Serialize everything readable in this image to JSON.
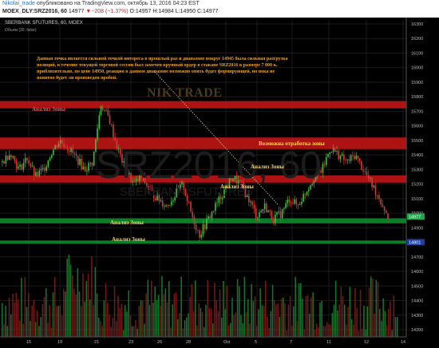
{
  "header": {
    "author": "Nikolai_trade",
    "published": "опубликовано на TradingView.com, октябрь 13, 2016 04:23 EST",
    "symbol": "MOEX_DLY:SRZ2016, 60",
    "last": "14977",
    "change": "▼−208 (−1.37%)",
    "ohlc": "O:14957 H:14984 L:14950 C:14977"
  },
  "chart_title": "SBERBANK SFUTURES, 60, MOEX",
  "volume_label": "Объем (20, false)",
  "watermark": "NIK TRADE",
  "background_symbol": "SRZ2016, 60",
  "background_desc": "SBERBANK SFUTURES",
  "comment": "Данная точка является сильной точкой интереса в прошлый раз и диапазоне вокруг 14945 была сильная разгрузка позиций, в течение текущей торговой сессии был замечен крупный ордер в стакане SRZ2016 в размере 7 000 к. приблизительно, по цене 14950, реакция в данном диапазоне возможно опять будет формирующей, но пока не понятно будет ли произведен пробой.",
  "zone_labels": [
    {
      "text": "Анализ Зоны",
      "color": "#ff4d4d"
    },
    {
      "text": "Возможна отработка зоны",
      "color": "#ffd54a"
    },
    {
      "text": "Анализ Зоны",
      "color": "#ffd54a"
    },
    {
      "text": "Анализ Зоны",
      "color": "#ffd54a"
    },
    {
      "text": "Анализ Зоны",
      "color": "#ffd54a"
    },
    {
      "text": "Анализ Зоны",
      "color": "#ffd54a"
    }
  ],
  "chart_data": {
    "type": "candlestick",
    "x_ticks": [
      "15",
      "19",
      "21",
      "23",
      "26",
      "28",
      "Oct",
      "5",
      "7",
      "11",
      "12",
      "14"
    ],
    "y_ticks": [
      16300,
      16200,
      16100,
      16000,
      15900,
      15800,
      15700,
      15600,
      15500,
      15400,
      15300,
      15200,
      15100,
      15000,
      14900,
      14800,
      14700,
      14600,
      14500,
      14400,
      14300,
      14200
    ],
    "ylim": [
      14150,
      16350
    ],
    "price_badges": [
      {
        "value": "14977",
        "color": "#1fa84a"
      },
      {
        "value": "14801",
        "color": "#1f3fa0"
      }
    ],
    "zones": [
      {
        "low": 15720,
        "high": 15770,
        "color": "#c01515"
      },
      {
        "low": 15440,
        "high": 15520,
        "color": "#c01515"
      },
      {
        "low": 15210,
        "high": 15260,
        "color": "#c01515"
      },
      {
        "low": 14930,
        "high": 14965,
        "color": "#0e8a2a"
      },
      {
        "low": 14790,
        "high": 14812,
        "color": "#0e8a2a"
      }
    ],
    "volume": "histogram at bottom of panel, red and green bars",
    "approx_close_path": [
      15350,
      15420,
      15300,
      15380,
      15250,
      15300,
      15420,
      15500,
      15450,
      15380,
      15300,
      15350,
      15750,
      15650,
      15450,
      15300,
      15200,
      15250,
      15150,
      15100,
      15050,
      15120,
      15200,
      15000,
      14850,
      14950,
      15050,
      15150,
      15250,
      15200,
      15100,
      14980,
      15050,
      14960,
      15000,
      15100,
      15050,
      15150,
      15250,
      15300,
      15450,
      15400,
      15350,
      15400,
      15300,
      15200,
      15100,
      14977
    ]
  }
}
